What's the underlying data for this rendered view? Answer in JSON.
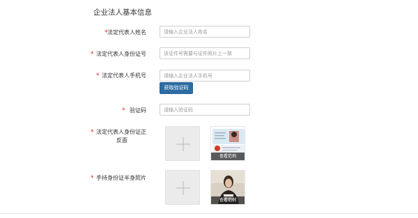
{
  "section": {
    "title": "企业法人基本信息"
  },
  "fields": {
    "name": {
      "label": "法定代表人姓名",
      "placeholder": "请输入企业法人姓名"
    },
    "id_number": {
      "label": "法定代表人身份证号",
      "placeholder": "该证件号需要与证件照片上一致"
    },
    "phone": {
      "label": "法定代表人手机号",
      "placeholder": "请输入企业法人手机号"
    },
    "code": {
      "label": "验证码",
      "placeholder": "请输入验证码"
    }
  },
  "buttons": {
    "get_code": "获取验证码"
  },
  "uploads": {
    "id_card": {
      "label_line1": "法定代表人身份证正",
      "label_line2": "反面",
      "sample_label": "查看范例"
    },
    "holding": {
      "label": "手持身份证半身照片",
      "sample_label": "查看范例"
    }
  },
  "required_mark": "*"
}
